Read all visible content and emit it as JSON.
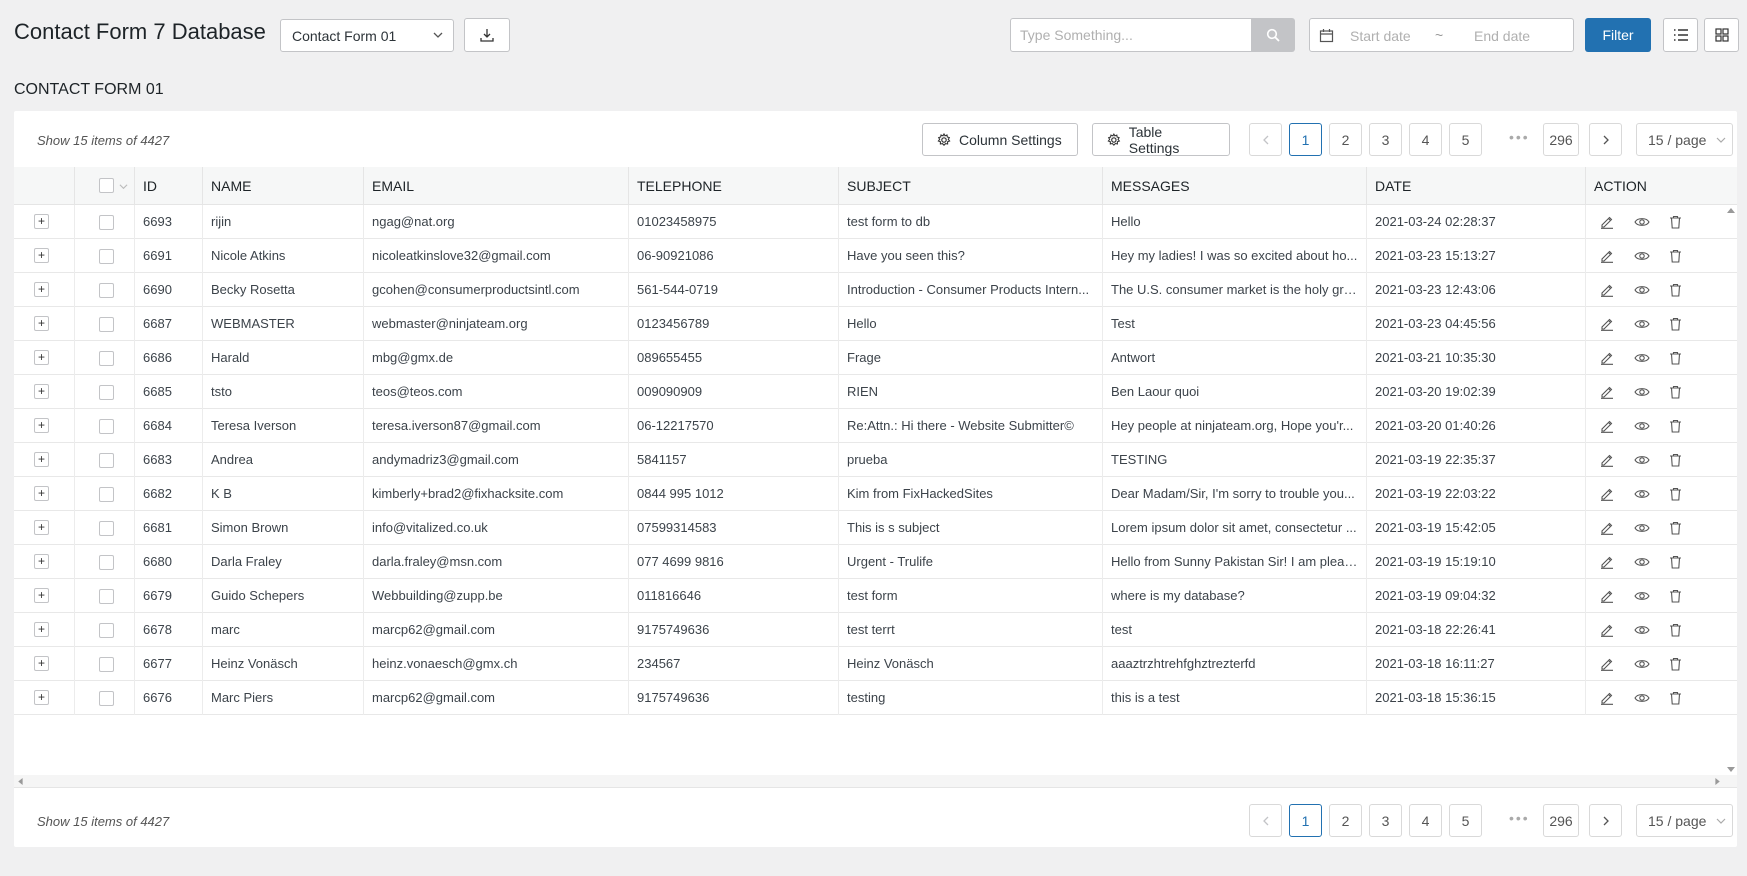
{
  "header": {
    "title": "Contact Form 7 Database",
    "form_select": "Contact Form 01",
    "search_placeholder": "Type Something...",
    "start_date_placeholder": "Start date",
    "date_separator": "~",
    "end_date_placeholder": "End date",
    "filter_label": "Filter"
  },
  "section": {
    "title": "CONTACT FORM 01"
  },
  "toolbar": {
    "show_text": "Show 15 items of 4427",
    "column_settings": "Column Settings",
    "table_settings": "Table Settings"
  },
  "pagination": {
    "pages": [
      "1",
      "2",
      "3",
      "4",
      "5"
    ],
    "dots": "•••",
    "last_page": "296",
    "per_page": "15 / page",
    "current": 1
  },
  "table": {
    "columns": [
      "ID",
      "NAME",
      "EMAIL",
      "TELEPHONE",
      "SUBJECT",
      "MESSAGES",
      "DATE",
      "ACTION"
    ],
    "rows": [
      {
        "id": "6693",
        "name": "rijin",
        "email": "ngag@nat.org",
        "telephone": "01023458975",
        "subject": "test form to db",
        "messages": "Hello",
        "date": "2021-03-24 02:28:37"
      },
      {
        "id": "6691",
        "name": "Nicole Atkins",
        "email": "nicoleatkinslove32@gmail.com",
        "telephone": "06-90921086",
        "subject": "Have you seen this?",
        "messages": "Hey my ladies! I was so excited about ho...",
        "date": "2021-03-23 15:13:27"
      },
      {
        "id": "6690",
        "name": "Becky Rosetta",
        "email": "gcohen@consumerproductsintl.com",
        "telephone": "561-544-0719",
        "subject": "Introduction - Consumer Products Intern...",
        "messages": "The U.S. consumer market is the holy grai...",
        "date": "2021-03-23 12:43:06"
      },
      {
        "id": "6687",
        "name": "WEBMASTER",
        "email": "webmaster@ninjateam.org",
        "telephone": "0123456789",
        "subject": "Hello",
        "messages": "Test",
        "date": "2021-03-23 04:45:56"
      },
      {
        "id": "6686",
        "name": "Harald",
        "email": "mbg@gmx.de",
        "telephone": "089655455",
        "subject": "Frage",
        "messages": "Antwort",
        "date": "2021-03-21 10:35:30"
      },
      {
        "id": "6685",
        "name": "tsto",
        "email": "teos@teos.com",
        "telephone": "009090909",
        "subject": "RIEN",
        "messages": "Ben Laour quoi",
        "date": "2021-03-20 19:02:39"
      },
      {
        "id": "6684",
        "name": "Teresa Iverson",
        "email": "teresa.iverson87@gmail.com",
        "telephone": "06-12217570",
        "subject": "Re:Attn.: Hi there - Website Submitter©",
        "messages": "Hey people at ninjateam.org, Hope you'r...",
        "date": "2021-03-20 01:40:26"
      },
      {
        "id": "6683",
        "name": "Andrea",
        "email": "andymadriz3@gmail.com",
        "telephone": "5841157",
        "subject": "prueba",
        "messages": "TESTING",
        "date": "2021-03-19 22:35:37"
      },
      {
        "id": "6682",
        "name": "K B",
        "email": "kimberly+brad2@fixhacksite.com",
        "telephone": "0844 995 1012",
        "subject": "Kim from FixHackedSites",
        "messages": "Dear Madam/Sir, I'm sorry to trouble you...",
        "date": "2021-03-19 22:03:22"
      },
      {
        "id": "6681",
        "name": "Simon Brown",
        "email": "info@vitalized.co.uk",
        "telephone": "07599314583",
        "subject": "This is s subject",
        "messages": "Lorem ipsum dolor sit amet, consectetur ...",
        "date": "2021-03-19 15:42:05"
      },
      {
        "id": "6680",
        "name": "Darla Fraley",
        "email": "darla.fraley@msn.com",
        "telephone": "077 4699 9816",
        "subject": "Urgent - Trulife",
        "messages": "Hello from Sunny Pakistan Sir! I am pleas...",
        "date": "2021-03-19 15:19:10"
      },
      {
        "id": "6679",
        "name": "Guido Schepers",
        "email": "Webbuilding@zupp.be",
        "telephone": "011816646",
        "subject": "test form",
        "messages": "where is my database?",
        "date": "2021-03-19 09:04:32"
      },
      {
        "id": "6678",
        "name": "marc",
        "email": "marcp62@gmail.com",
        "telephone": "9175749636",
        "subject": "test terrt",
        "messages": "test",
        "date": "2021-03-18 22:26:41"
      },
      {
        "id": "6677",
        "name": "Heinz Vonäsch",
        "email": "heinz.vonaesch@gmx.ch",
        "telephone": "234567",
        "subject": "Heinz Vonäsch",
        "messages": "aaaztrzhtrehfghztrezterfd",
        "date": "2021-03-18 16:11:27"
      },
      {
        "id": "6676",
        "name": "Marc Piers",
        "email": "marcp62@gmail.com",
        "telephone": "9175749636",
        "subject": "testing",
        "messages": "this is a test",
        "date": "2021-03-18 15:36:15"
      }
    ]
  },
  "colors": {
    "primary": "#2271b1",
    "background": "#f0f0f1"
  }
}
